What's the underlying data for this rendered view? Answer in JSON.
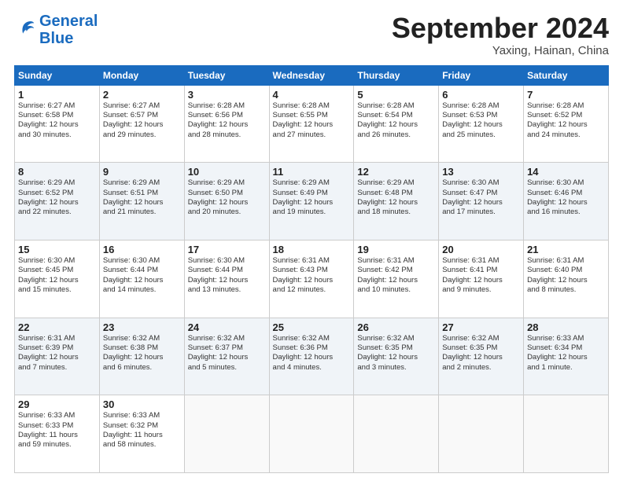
{
  "header": {
    "logo_general": "General",
    "logo_blue": "Blue",
    "month_title": "September 2024",
    "location": "Yaxing, Hainan, China"
  },
  "weekdays": [
    "Sunday",
    "Monday",
    "Tuesday",
    "Wednesday",
    "Thursday",
    "Friday",
    "Saturday"
  ],
  "weeks": [
    [
      {
        "day": "1",
        "lines": [
          "Sunrise: 6:27 AM",
          "Sunset: 6:58 PM",
          "Daylight: 12 hours",
          "and 30 minutes."
        ]
      },
      {
        "day": "2",
        "lines": [
          "Sunrise: 6:27 AM",
          "Sunset: 6:57 PM",
          "Daylight: 12 hours",
          "and 29 minutes."
        ]
      },
      {
        "day": "3",
        "lines": [
          "Sunrise: 6:28 AM",
          "Sunset: 6:56 PM",
          "Daylight: 12 hours",
          "and 28 minutes."
        ]
      },
      {
        "day": "4",
        "lines": [
          "Sunrise: 6:28 AM",
          "Sunset: 6:55 PM",
          "Daylight: 12 hours",
          "and 27 minutes."
        ]
      },
      {
        "day": "5",
        "lines": [
          "Sunrise: 6:28 AM",
          "Sunset: 6:54 PM",
          "Daylight: 12 hours",
          "and 26 minutes."
        ]
      },
      {
        "day": "6",
        "lines": [
          "Sunrise: 6:28 AM",
          "Sunset: 6:53 PM",
          "Daylight: 12 hours",
          "and 25 minutes."
        ]
      },
      {
        "day": "7",
        "lines": [
          "Sunrise: 6:28 AM",
          "Sunset: 6:52 PM",
          "Daylight: 12 hours",
          "and 24 minutes."
        ]
      }
    ],
    [
      {
        "day": "8",
        "lines": [
          "Sunrise: 6:29 AM",
          "Sunset: 6:52 PM",
          "Daylight: 12 hours",
          "and 22 minutes."
        ]
      },
      {
        "day": "9",
        "lines": [
          "Sunrise: 6:29 AM",
          "Sunset: 6:51 PM",
          "Daylight: 12 hours",
          "and 21 minutes."
        ]
      },
      {
        "day": "10",
        "lines": [
          "Sunrise: 6:29 AM",
          "Sunset: 6:50 PM",
          "Daylight: 12 hours",
          "and 20 minutes."
        ]
      },
      {
        "day": "11",
        "lines": [
          "Sunrise: 6:29 AM",
          "Sunset: 6:49 PM",
          "Daylight: 12 hours",
          "and 19 minutes."
        ]
      },
      {
        "day": "12",
        "lines": [
          "Sunrise: 6:29 AM",
          "Sunset: 6:48 PM",
          "Daylight: 12 hours",
          "and 18 minutes."
        ]
      },
      {
        "day": "13",
        "lines": [
          "Sunrise: 6:30 AM",
          "Sunset: 6:47 PM",
          "Daylight: 12 hours",
          "and 17 minutes."
        ]
      },
      {
        "day": "14",
        "lines": [
          "Sunrise: 6:30 AM",
          "Sunset: 6:46 PM",
          "Daylight: 12 hours",
          "and 16 minutes."
        ]
      }
    ],
    [
      {
        "day": "15",
        "lines": [
          "Sunrise: 6:30 AM",
          "Sunset: 6:45 PM",
          "Daylight: 12 hours",
          "and 15 minutes."
        ]
      },
      {
        "day": "16",
        "lines": [
          "Sunrise: 6:30 AM",
          "Sunset: 6:44 PM",
          "Daylight: 12 hours",
          "and 14 minutes."
        ]
      },
      {
        "day": "17",
        "lines": [
          "Sunrise: 6:30 AM",
          "Sunset: 6:44 PM",
          "Daylight: 12 hours",
          "and 13 minutes."
        ]
      },
      {
        "day": "18",
        "lines": [
          "Sunrise: 6:31 AM",
          "Sunset: 6:43 PM",
          "Daylight: 12 hours",
          "and 12 minutes."
        ]
      },
      {
        "day": "19",
        "lines": [
          "Sunrise: 6:31 AM",
          "Sunset: 6:42 PM",
          "Daylight: 12 hours",
          "and 10 minutes."
        ]
      },
      {
        "day": "20",
        "lines": [
          "Sunrise: 6:31 AM",
          "Sunset: 6:41 PM",
          "Daylight: 12 hours",
          "and 9 minutes."
        ]
      },
      {
        "day": "21",
        "lines": [
          "Sunrise: 6:31 AM",
          "Sunset: 6:40 PM",
          "Daylight: 12 hours",
          "and 8 minutes."
        ]
      }
    ],
    [
      {
        "day": "22",
        "lines": [
          "Sunrise: 6:31 AM",
          "Sunset: 6:39 PM",
          "Daylight: 12 hours",
          "and 7 minutes."
        ]
      },
      {
        "day": "23",
        "lines": [
          "Sunrise: 6:32 AM",
          "Sunset: 6:38 PM",
          "Daylight: 12 hours",
          "and 6 minutes."
        ]
      },
      {
        "day": "24",
        "lines": [
          "Sunrise: 6:32 AM",
          "Sunset: 6:37 PM",
          "Daylight: 12 hours",
          "and 5 minutes."
        ]
      },
      {
        "day": "25",
        "lines": [
          "Sunrise: 6:32 AM",
          "Sunset: 6:36 PM",
          "Daylight: 12 hours",
          "and 4 minutes."
        ]
      },
      {
        "day": "26",
        "lines": [
          "Sunrise: 6:32 AM",
          "Sunset: 6:35 PM",
          "Daylight: 12 hours",
          "and 3 minutes."
        ]
      },
      {
        "day": "27",
        "lines": [
          "Sunrise: 6:32 AM",
          "Sunset: 6:35 PM",
          "Daylight: 12 hours",
          "and 2 minutes."
        ]
      },
      {
        "day": "28",
        "lines": [
          "Sunrise: 6:33 AM",
          "Sunset: 6:34 PM",
          "Daylight: 12 hours",
          "and 1 minute."
        ]
      }
    ],
    [
      {
        "day": "29",
        "lines": [
          "Sunrise: 6:33 AM",
          "Sunset: 6:33 PM",
          "Daylight: 11 hours",
          "and 59 minutes."
        ]
      },
      {
        "day": "30",
        "lines": [
          "Sunrise: 6:33 AM",
          "Sunset: 6:32 PM",
          "Daylight: 11 hours",
          "and 58 minutes."
        ]
      },
      {
        "day": "",
        "lines": []
      },
      {
        "day": "",
        "lines": []
      },
      {
        "day": "",
        "lines": []
      },
      {
        "day": "",
        "lines": []
      },
      {
        "day": "",
        "lines": []
      }
    ]
  ]
}
